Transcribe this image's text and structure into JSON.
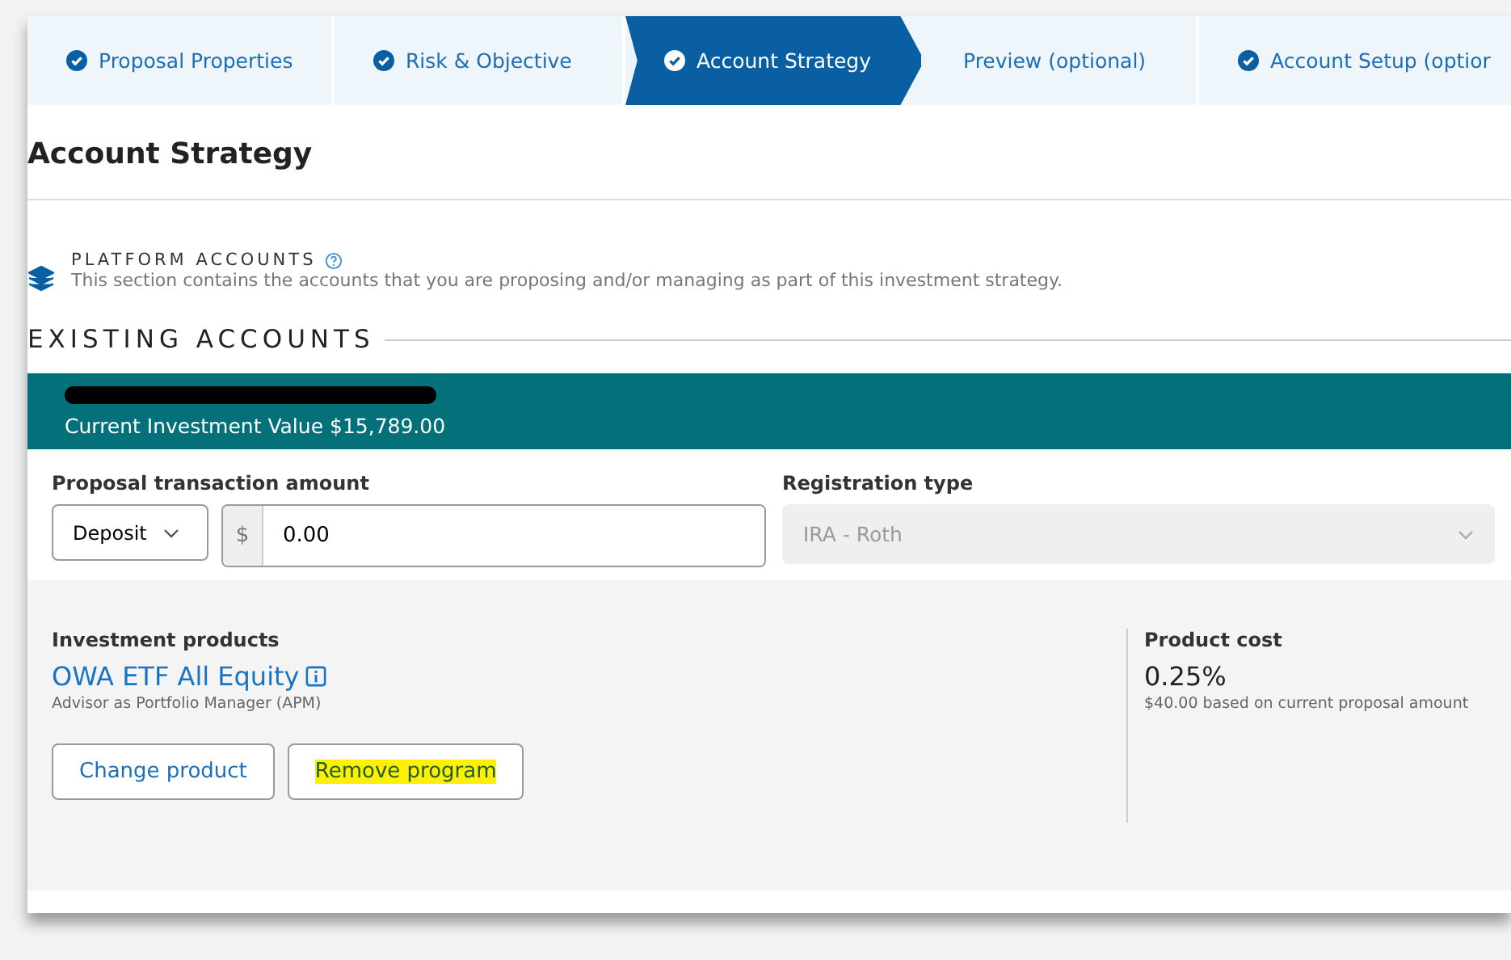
{
  "steps": [
    {
      "label": "Proposal Properties",
      "completed": true,
      "selected": false
    },
    {
      "label": "Risk & Objective",
      "completed": true,
      "selected": false
    },
    {
      "label": "Account Strategy",
      "completed": true,
      "selected": true
    },
    {
      "label": "Preview (optional)",
      "completed": false,
      "selected": false
    },
    {
      "label": "Account Setup (optior",
      "completed": true,
      "selected": false
    }
  ],
  "page_title": "Account Strategy",
  "platform": {
    "title": "PLATFORM ACCOUNTS",
    "description": "This section contains the accounts that you are proposing and/or managing as part of this investment strategy."
  },
  "existing_heading": "EXISTING ACCOUNTS",
  "account": {
    "name_redacted": true,
    "value": "Current Investment Value $15,789.00"
  },
  "transaction": {
    "label": "Proposal transaction amount",
    "type": "Deposit",
    "currency": "$",
    "amount": "0.00"
  },
  "registration": {
    "label": "Registration type",
    "value": "IRA - Roth",
    "disabled": true
  },
  "products": {
    "label": "Investment products",
    "name": "OWA ETF All Equity",
    "subtitle": "Advisor as Portfolio Manager (APM)"
  },
  "buttons": [
    {
      "label": "Change product",
      "highlighted": false
    },
    {
      "label": "Remove program",
      "highlighted": true
    }
  ],
  "cost": {
    "label": "Product cost",
    "value": "0.25%",
    "note": "$40.00 based on current proposal amount"
  }
}
